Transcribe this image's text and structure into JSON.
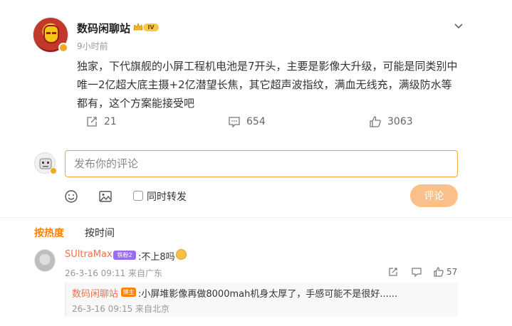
{
  "post": {
    "author": "数码闲聊站",
    "vip_level": "IV",
    "time": "9小时前",
    "text": "独家，下代旗舰的小屏工程机电池是7开头，主要是影像大升级，可能是同类别中唯一2亿超大底主摄+2亿潜望长焦，其它超声波指纹，满血无线充，满级防水等都有，这个方案能接受吧",
    "reposts": "21",
    "comments": "654",
    "likes": "3063"
  },
  "composer": {
    "placeholder": "发布你的评论",
    "repost_label": "同时转发",
    "submit_label": "评论"
  },
  "sort": {
    "hot": "按热度",
    "time": "按时间"
  },
  "comments": [
    {
      "name": "SUltraMax",
      "badge": "铁粉2",
      "text": ":不上8吗",
      "meta": "26-3-16 09:11 来自广东",
      "likes": "57",
      "reply": {
        "name": "数码闲聊站",
        "badge": "博主",
        "text": ":小屏堆影像再做8000mah机身太厚了，手感可能不是很好......",
        "meta": "26-3-16 09:15 来自北京"
      }
    }
  ],
  "colors": {
    "accent": "#ff8200",
    "username": "#eb7350",
    "input_border": "#f5a83c",
    "submit_bg": "#fbc08a"
  },
  "icons": [
    "chevron-down-icon",
    "share-icon",
    "comment-icon",
    "like-icon",
    "emoji-icon",
    "image-icon",
    "crown-icon"
  ]
}
